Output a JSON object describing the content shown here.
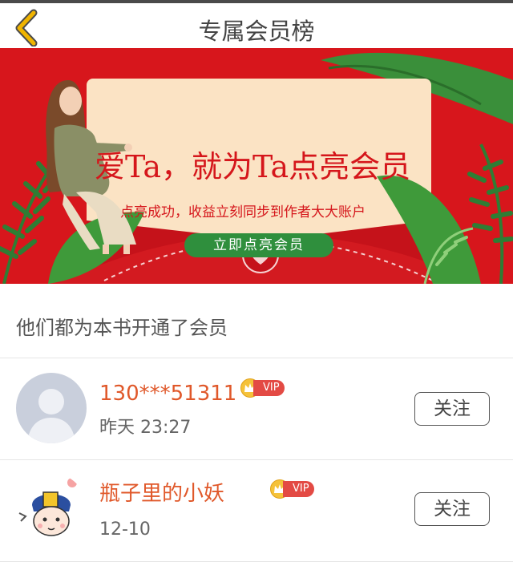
{
  "header": {
    "title": "专属会员榜",
    "back_icon": "chevron-left-icon",
    "accent_color": "#f0b400"
  },
  "banner": {
    "headline": "爱Ta，就为Ta点亮会员",
    "subtitle": "点亮成功，收益立刻同步到作者大大账户",
    "cta_label": "立即点亮会员",
    "background_color": "#d7161c",
    "card_color": "#fbe3c4",
    "cta_color": "#2f8f3d"
  },
  "members_section": {
    "title": "他们都为本书开通了会员"
  },
  "members": [
    {
      "name": "130***51311",
      "vip_label": "VIP",
      "time": "昨天 23:27",
      "follow_label": "关注",
      "avatar": "default-avatar-icon"
    },
    {
      "name": "瓶子里的小妖",
      "vip_label": "VIP",
      "time": "12-10",
      "follow_label": "关注",
      "avatar": "cartoon-avatar-icon"
    }
  ]
}
